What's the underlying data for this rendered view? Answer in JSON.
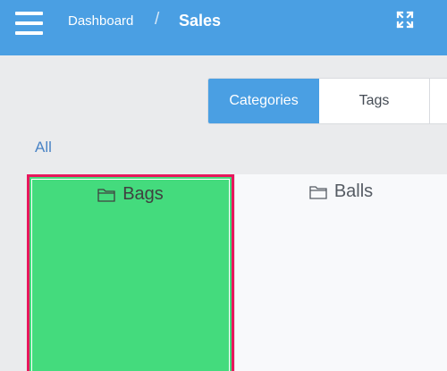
{
  "header": {
    "breadcrumb_root": "Dashboard",
    "breadcrumb_separator": "/",
    "breadcrumb_current": "Sales",
    "menu_icon": "hamburger-menu-icon",
    "fullscreen_icon": "expand-arrows-icon",
    "color": "#4a9fe3"
  },
  "tabs": [
    {
      "label": "Categories",
      "active": true
    },
    {
      "label": "Tags",
      "active": false
    }
  ],
  "filter": {
    "all_label": "All"
  },
  "categories": [
    {
      "label": "Bags",
      "icon": "folder-icon",
      "selected": true,
      "color": "#44db7d"
    },
    {
      "label": "Balls",
      "icon": "folder-icon",
      "selected": false
    }
  ],
  "colors": {
    "accent": "#4a9fe3",
    "selected_tile": "#44db7d",
    "selection_border": "#e8175d"
  }
}
